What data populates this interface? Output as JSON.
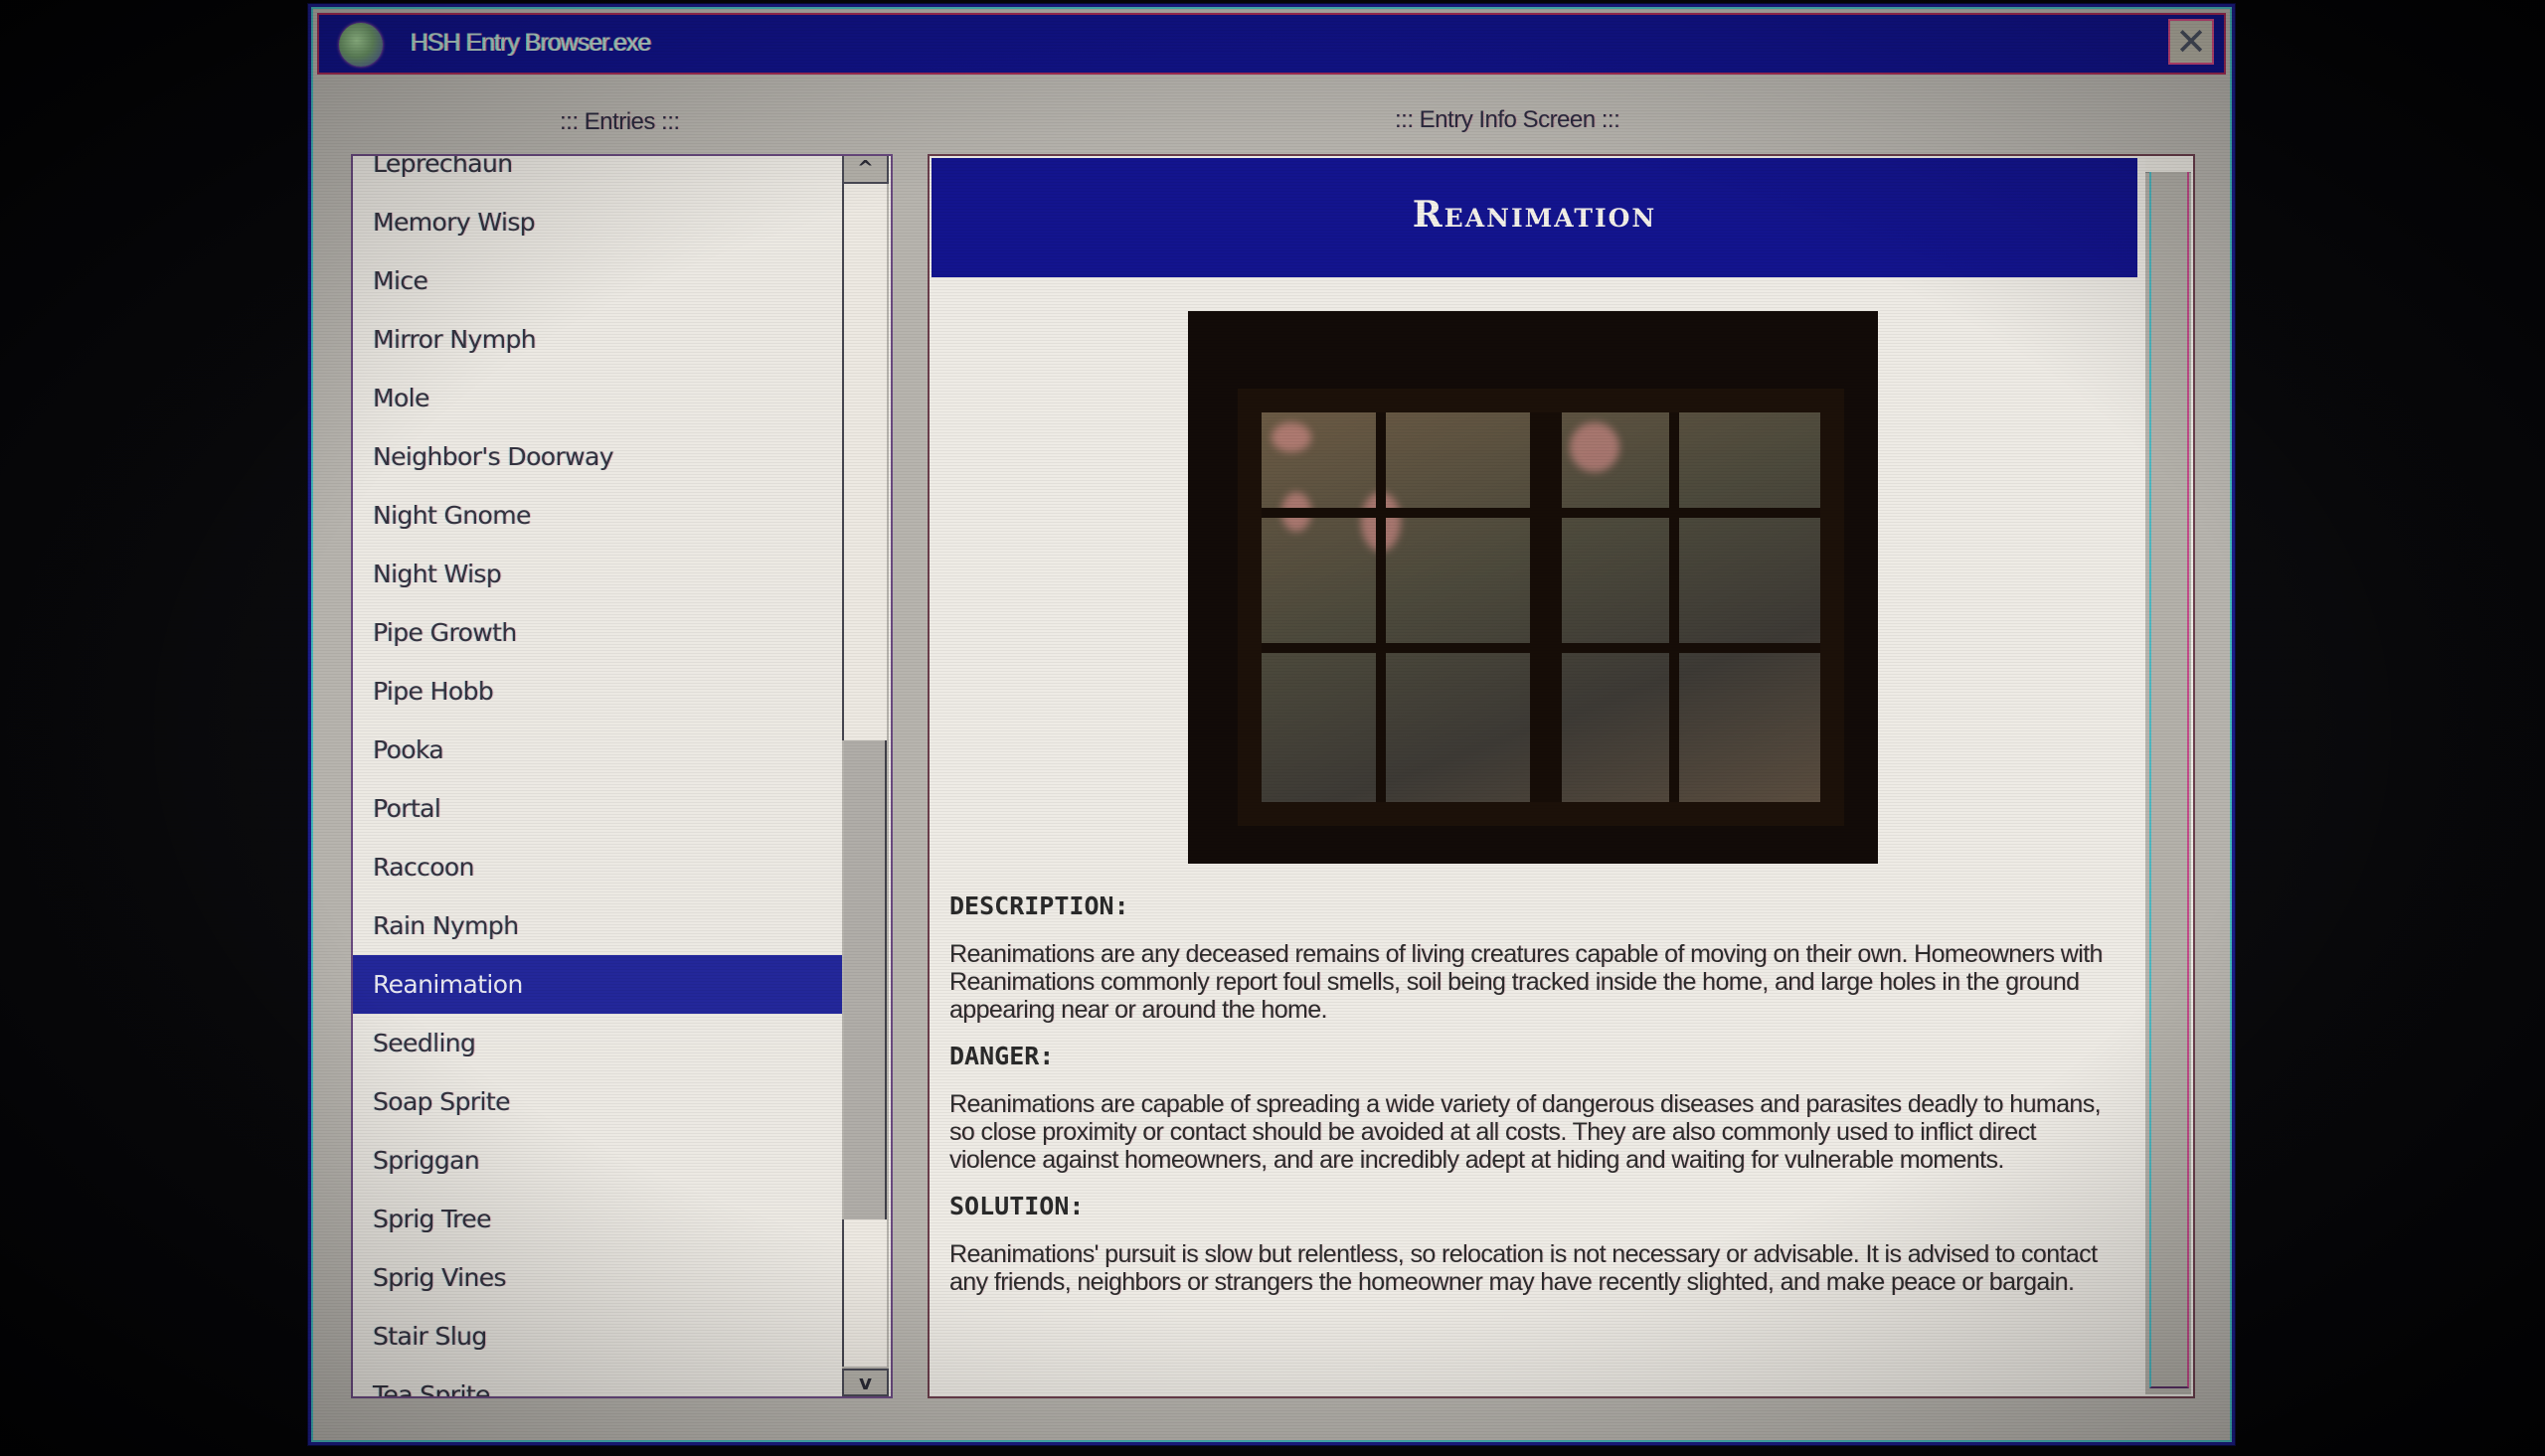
{
  "window": {
    "title": "HSH Entry Browser.exe",
    "app_icon": "globe-icon",
    "close_glyph": "✕"
  },
  "entries_panel": {
    "label": "::: Entries :::",
    "scroll_up_glyph": "^",
    "scroll_down_glyph": "v",
    "scroll_position_fraction": 0.52,
    "items": [
      {
        "label": "Leprechaun",
        "selected": false
      },
      {
        "label": "Memory Wisp",
        "selected": false
      },
      {
        "label": "Mice",
        "selected": false
      },
      {
        "label": "Mirror Nymph",
        "selected": false
      },
      {
        "label": "Mole",
        "selected": false
      },
      {
        "label": "Neighbor's Doorway",
        "selected": false
      },
      {
        "label": "Night Gnome",
        "selected": false
      },
      {
        "label": "Night Wisp",
        "selected": false
      },
      {
        "label": "Pipe Growth",
        "selected": false
      },
      {
        "label": "Pipe Hobb",
        "selected": false
      },
      {
        "label": "Pooka",
        "selected": false
      },
      {
        "label": "Portal",
        "selected": false
      },
      {
        "label": "Raccoon",
        "selected": false
      },
      {
        "label": "Rain Nymph",
        "selected": false
      },
      {
        "label": "Reanimation",
        "selected": true
      },
      {
        "label": "Seedling",
        "selected": false
      },
      {
        "label": "Soap Sprite",
        "selected": false
      },
      {
        "label": "Spriggan",
        "selected": false
      },
      {
        "label": "Sprig Tree",
        "selected": false
      },
      {
        "label": "Sprig Vines",
        "selected": false
      },
      {
        "label": "Stair Slug",
        "selected": false
      },
      {
        "label": "Tea Sprite",
        "selected": false
      }
    ]
  },
  "info_panel": {
    "label": "::: Entry Info Screen :::",
    "title": "Reanimation",
    "image_alt": "Dark wooden window with multiple panes at night",
    "sections": [
      {
        "heading": "DESCRIPTION:",
        "text": "Reanimations are any deceased remains of living creatures capable of moving on their own. Homeowners with Reanimations commonly report  foul smells, soil being tracked inside the home, and large holes in the ground appearing near or around the home."
      },
      {
        "heading": "DANGER:",
        "text": "Reanimations are capable of spreading a wide variety of dangerous diseases and parasites deadly to humans, so close proximity or contact should be avoided at all costs. They are also commonly used to inflict direct violence against homeowners, and are incredibly adept at hiding and waiting for vulnerable moments."
      },
      {
        "heading": "SOLUTION:",
        "text": "Reanimations' pursuit is slow but relentless, so relocation is not necessary or advisable. It is advised to contact any friends, neighbors or strangers the homeowner may have recently slighted, and make peace or bargain."
      }
    ]
  },
  "colors": {
    "titlebar": "#11138a",
    "selection": "#23279a",
    "window_face": "#b7b4ae",
    "list_background": "#ece9e3"
  }
}
